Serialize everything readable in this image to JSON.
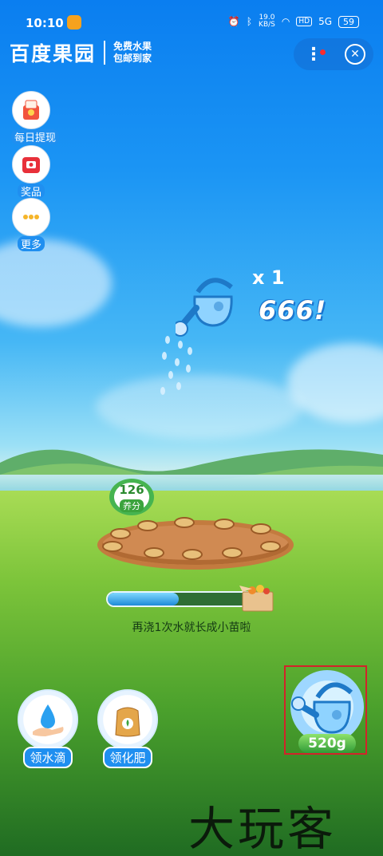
{
  "status_bar": {
    "time": "10:10",
    "speed_value": "19.0",
    "speed_unit": "KB/S",
    "hd": "HD",
    "network": "5G",
    "battery": "59"
  },
  "header": {
    "brand": "百度果园",
    "tagline_line1": "免费水果",
    "tagline_line2": "包邮到家",
    "more_icon": "⋮",
    "close_icon": "✕"
  },
  "side_menu": [
    {
      "label": "每日提现",
      "icon": "cash-gift-icon"
    },
    {
      "label": "奖品",
      "icon": "prize-box-icon"
    },
    {
      "label": "更多",
      "icon": "more-dots-icon"
    }
  ],
  "combo": {
    "multiplier": "x 1",
    "praise": "666!"
  },
  "nutrient": {
    "value": "126",
    "label": "养分"
  },
  "growth": {
    "progress": 0.48,
    "hint": "再浇1次水就长成小苗啦"
  },
  "actions": {
    "get_water_label": "领水滴",
    "get_fertilizer_label": "领化肥",
    "water_amount": "520g"
  },
  "watermark": "大玩客",
  "colors": {
    "accent_blue": "#1f8ff0",
    "grass_green": "#4aa02c",
    "highlight_red": "#d2232a"
  }
}
